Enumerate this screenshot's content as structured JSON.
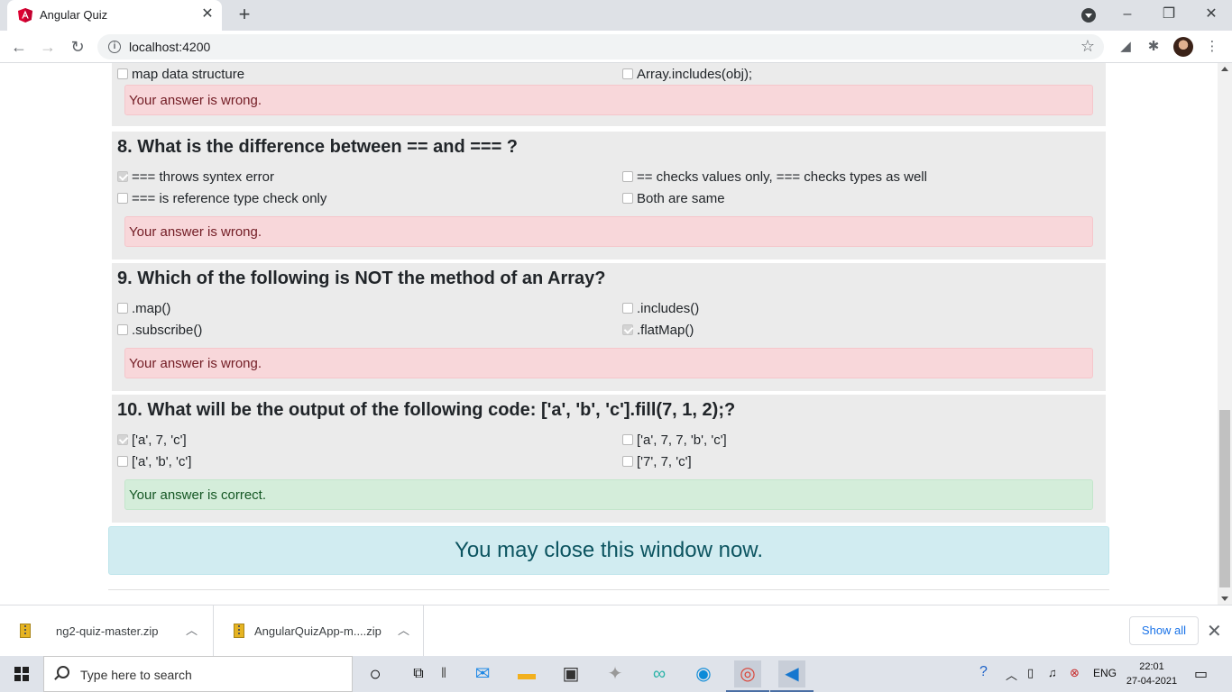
{
  "browser": {
    "tab_title": "Angular Quiz",
    "tab_close": "✕",
    "new_tab": "+",
    "url": "localhost:4200",
    "window_controls": {
      "minimize": "–",
      "restore": "❐",
      "close": "✕"
    }
  },
  "quiz": {
    "partial_question": {
      "options": [
        {
          "label": "map data structure",
          "checked": false
        },
        {
          "label": "Array.includes(obj);",
          "checked": false
        }
      ],
      "result": "Your answer is wrong."
    },
    "questions": [
      {
        "title": "8. What is the difference between == and === ?",
        "options": [
          {
            "label": "=== throws syntex error",
            "checked": true
          },
          {
            "label": "== checks values only, === checks types as well",
            "checked": false
          },
          {
            "label": "=== is reference type check only",
            "checked": false
          },
          {
            "label": "Both are same",
            "checked": false
          }
        ],
        "result": "Your answer is wrong.",
        "correct": false
      },
      {
        "title": "9. Which of the following is NOT the method of an Array?",
        "options": [
          {
            "label": ".map()",
            "checked": false
          },
          {
            "label": ".includes()",
            "checked": false
          },
          {
            "label": ".subscribe()",
            "checked": false
          },
          {
            "label": ".flatMap()",
            "checked": true
          }
        ],
        "result": "Your answer is wrong.",
        "correct": false
      },
      {
        "title": "10. What will be the output of the following code: ['a', 'b', 'c'].fill(7, 1, 2);?",
        "options": [
          {
            "label": "['a', 7, 'c']",
            "checked": true
          },
          {
            "label": "['a', 7, 7, 'b', 'c']",
            "checked": false
          },
          {
            "label": "['a', 'b', 'c']",
            "checked": false
          },
          {
            "label": "['7', 7, 'c']",
            "checked": false
          }
        ],
        "result": "Your answer is correct.",
        "correct": true
      }
    ],
    "close_message": "You may close this window now."
  },
  "downloads": {
    "items": [
      {
        "name": "ng2-quiz-master.zip"
      },
      {
        "name": "AngularQuizApp-m....zip"
      }
    ],
    "show_all": "Show all",
    "close": "✕"
  },
  "taskbar": {
    "search_placeholder": "Type here to search",
    "language": "ENG",
    "time": "22:01",
    "date": "27-04-2021"
  }
}
